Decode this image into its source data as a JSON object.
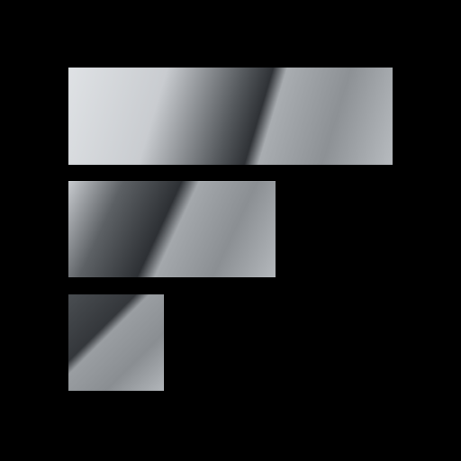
{
  "logo": {
    "icon": "stepped-bars-logo-icon",
    "background_color": "#000000",
    "gradient_colors": {
      "highlight": "#e4e7ea",
      "light": "#c6c9cd",
      "mid": "#8c9094",
      "dark": "#3c3f43",
      "shine": "#b8bcc0"
    }
  }
}
